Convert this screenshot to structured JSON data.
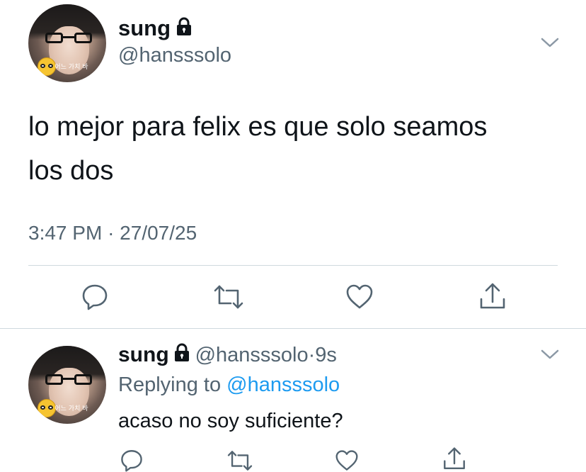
{
  "main_tweet": {
    "author_name": "sung",
    "handle": "@hansssolo",
    "avatar_caption": "어느 가치 바",
    "text_line1": "lo mejor para felix es que solo seamos",
    "text_line2": "los dos",
    "time": "3:47 PM",
    "separator": "·",
    "date": "27/07/25"
  },
  "reply": {
    "author_name": "sung",
    "handle": "@hansssolo",
    "separator": "·",
    "age": "9s",
    "replying_to_label": "Replying to",
    "replying_to_handle": "@hansssolo",
    "text": "acaso no soy suficiente?",
    "avatar_caption": "어느 가치 바"
  },
  "icons": {
    "lock": "lock-icon",
    "chevron": "chevron-down-icon",
    "reply": "reply-icon",
    "retweet": "retweet-icon",
    "like": "heart-icon",
    "share": "share-icon"
  },
  "colors": {
    "text": "#0f1419",
    "secondary": "#536471",
    "link": "#1d9bf0",
    "divider": "#cfd9de"
  }
}
